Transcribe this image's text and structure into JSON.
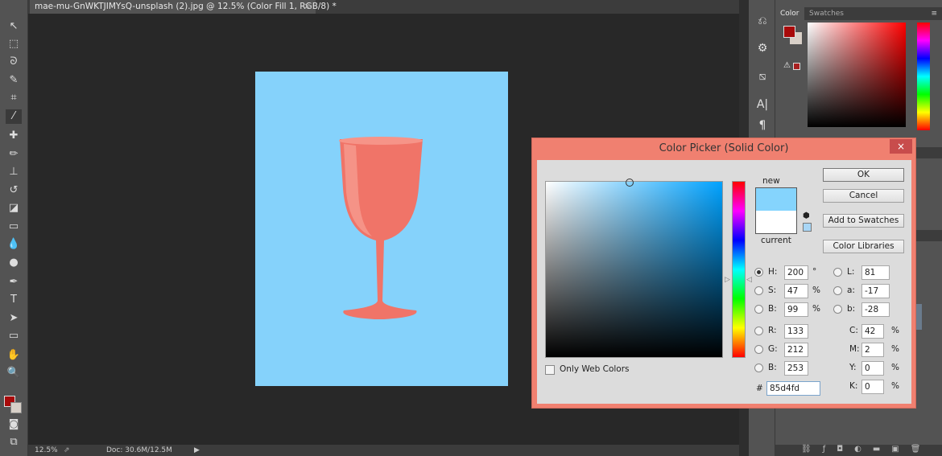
{
  "document": {
    "tab_title": "mae-mu-GnWKTJIMYsQ-unsplash (2).jpg @ 12.5% (Color Fill 1, RGB/8) *",
    "close": "×"
  },
  "status": {
    "zoom": "12.5%",
    "doc": "Doc: 30.6M/12.5M",
    "arrow": "▶"
  },
  "panels": {
    "color_tab": "Color",
    "swatches_tab": "Swatches"
  },
  "colors": {
    "foreground": "#a80a0a",
    "background": "#d8d0c8",
    "image_bg": "#85d2fb",
    "glass": "#f07468",
    "dialog_frame": "#f08070"
  },
  "dialog": {
    "title": "Color Picker (Solid Color)",
    "close": "×",
    "new_label": "new",
    "current_label": "current",
    "new_color": "#85d4fd",
    "current_color": "#ffffff",
    "buttons": {
      "ok": "OK",
      "cancel": "Cancel",
      "add_swatches": "Add to Swatches",
      "libraries": "Color Libraries"
    },
    "only_web": "Only Web Colors",
    "only_web_checked": false,
    "hsb": [
      {
        "label": "H:",
        "value": "200",
        "unit": "°",
        "selected": true
      },
      {
        "label": "S:",
        "value": "47",
        "unit": "%",
        "selected": false
      },
      {
        "label": "B:",
        "value": "99",
        "unit": "%",
        "selected": false
      }
    ],
    "rgb": [
      {
        "label": "R:",
        "value": "133"
      },
      {
        "label": "G:",
        "value": "212"
      },
      {
        "label": "B:",
        "value": "253"
      }
    ],
    "lab": [
      {
        "label": "L:",
        "value": "81"
      },
      {
        "label": "a:",
        "value": "-17"
      },
      {
        "label": "b:",
        "value": "-28"
      }
    ],
    "cmyk": [
      {
        "label": "C:",
        "value": "42",
        "unit": "%"
      },
      {
        "label": "M:",
        "value": "2",
        "unit": "%"
      },
      {
        "label": "Y:",
        "value": "0",
        "unit": "%"
      },
      {
        "label": "K:",
        "value": "0",
        "unit": "%"
      }
    ],
    "hex_label": "#",
    "hex": "85d4fd"
  }
}
